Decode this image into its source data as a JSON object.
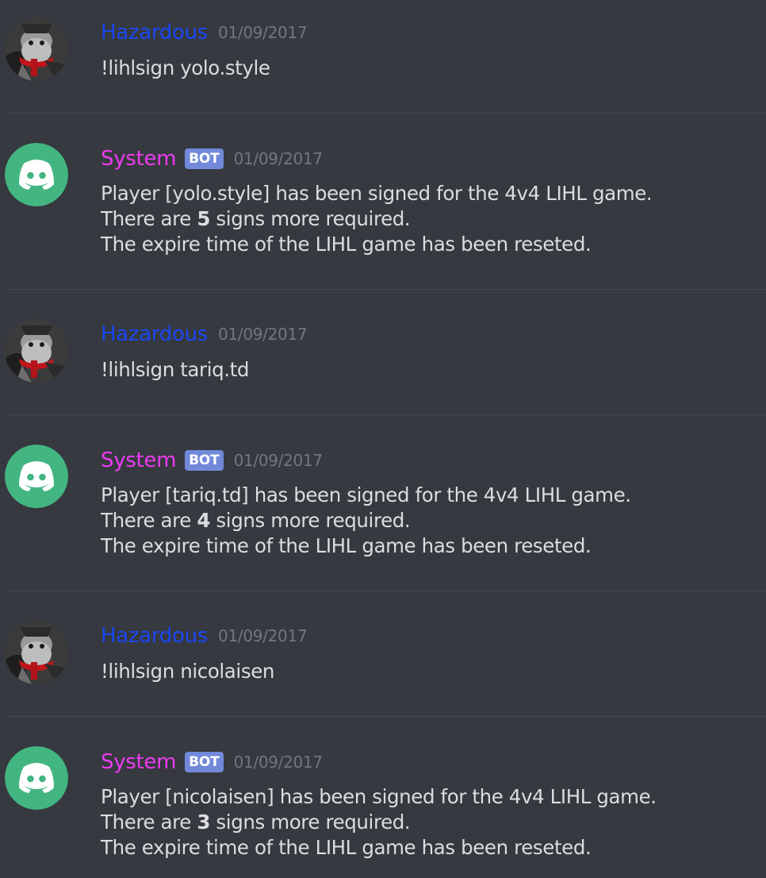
{
  "messages": [
    {
      "type": "user",
      "username": "Hazardous",
      "timestamp": "01/09/2017",
      "text": "!lihlsign yolo.style"
    },
    {
      "type": "bot",
      "username": "System",
      "bot_tag": "BOT",
      "timestamp": "01/09/2017",
      "line1": "Player [yolo.style] has been signed for the 4v4 LIHL game.",
      "line2_prefix": "There are ",
      "line2_count": "5",
      "line2_suffix": " signs more required.",
      "line3": "The expire time of the LIHL game has been reseted."
    },
    {
      "type": "user",
      "username": "Hazardous",
      "timestamp": "01/09/2017",
      "text": "!lihlsign tariq.td"
    },
    {
      "type": "bot",
      "username": "System",
      "bot_tag": "BOT",
      "timestamp": "01/09/2017",
      "line1": "Player [tariq.td] has been signed for the 4v4 LIHL game.",
      "line2_prefix": "There are ",
      "line2_count": "4",
      "line2_suffix": " signs more required.",
      "line3": "The expire time of the LIHL game has been reseted."
    },
    {
      "type": "user",
      "username": "Hazardous",
      "timestamp": "01/09/2017",
      "text": "!lihlsign nicolaisen"
    },
    {
      "type": "bot",
      "username": "System",
      "bot_tag": "BOT",
      "timestamp": "01/09/2017",
      "line1": "Player [nicolaisen] has been signed for the 4v4 LIHL game.",
      "line2_prefix": "There are ",
      "line2_count": "3",
      "line2_suffix": " signs more required.",
      "line3": "The expire time of the LIHL game has been reseted."
    }
  ],
  "colors": {
    "background": "#36393f",
    "user_name": "#1a47f2",
    "bot_name": "#ec3bf0",
    "bot_tag": "#7289da",
    "bot_avatar": "#43b581",
    "message_text": "#dcddde",
    "timestamp": "#72767d"
  },
  "icons": {
    "user_avatar": "hazardous-avatar-icon",
    "bot_avatar": "discord-logo-icon"
  }
}
